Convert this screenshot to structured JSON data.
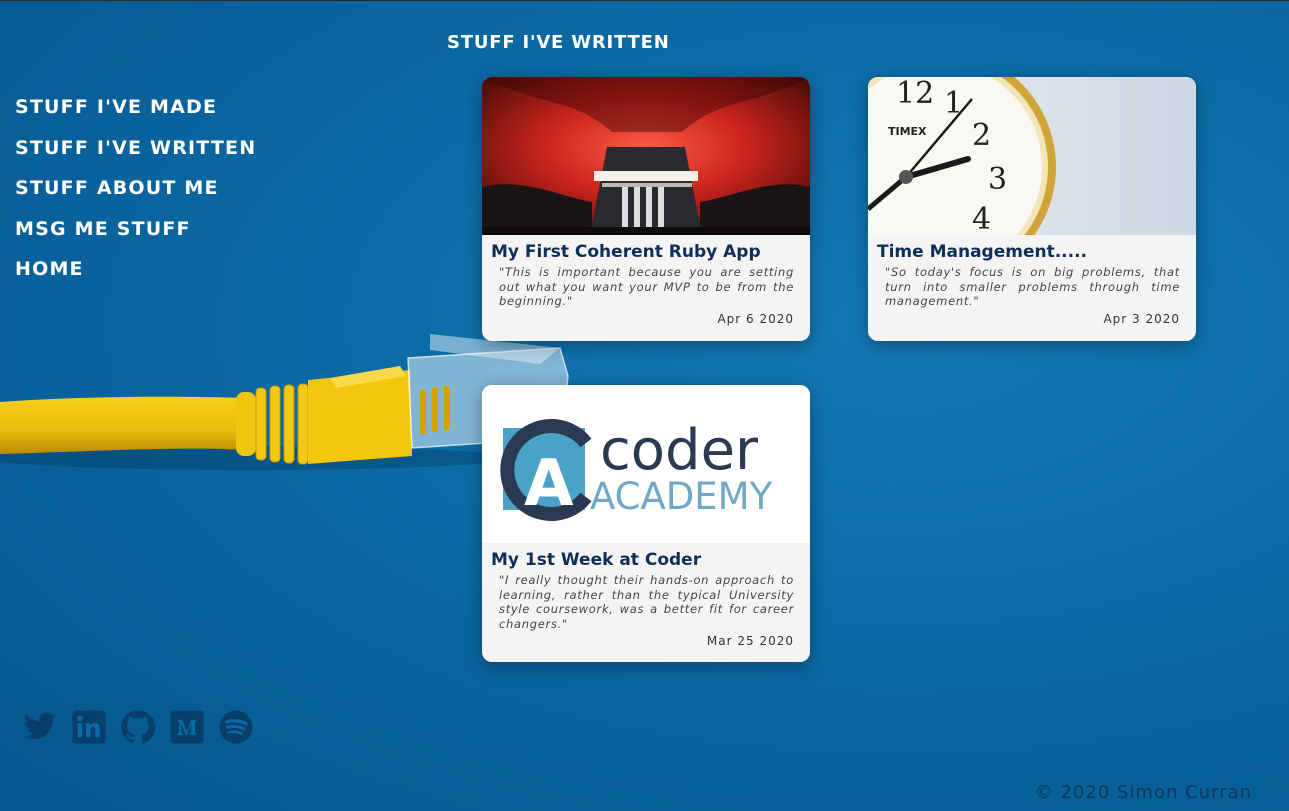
{
  "nav": {
    "items": [
      {
        "label": "STUFF I'VE MADE"
      },
      {
        "label": "STUFF I'VE WRITTEN"
      },
      {
        "label": "STUFF ABOUT ME"
      },
      {
        "label": "MSG ME STUFF"
      },
      {
        "label": "HOME"
      }
    ]
  },
  "page": {
    "section_title": "STUFF I'VE WRITTEN"
  },
  "posts": [
    {
      "title": "My First Coherent Ruby App",
      "excerpt": "\"This is important because you are setting out what you want your MVP to be from the beginning.\"",
      "date": "Apr 6 2020",
      "image": "red-cave-subway-station"
    },
    {
      "title": "Time Management.....",
      "excerpt": "\"So today's focus is on big problems, that turn into smaller problems through time management.\"",
      "date": "Apr 3 2020",
      "image": "timex-clock"
    },
    {
      "title": "My 1st Week at Coder",
      "excerpt": "\"I really thought their hands-on approach to learning, rather than the typical University style coursework, was a better fit for career changers.\"",
      "date": "Mar 25 2020",
      "image": "coder-academy-logo",
      "logo": {
        "line1": "coder",
        "line2": "ACADEMY",
        "letter": "A"
      }
    }
  ],
  "social": [
    {
      "icon": "twitter-icon"
    },
    {
      "icon": "linkedin-icon"
    },
    {
      "icon": "github-icon"
    },
    {
      "icon": "medium-icon"
    },
    {
      "icon": "spotify-icon"
    }
  ],
  "colors": {
    "accent": "#0f2f58",
    "icon": "#073f6a",
    "background": "#0b6aa6",
    "card": "#f4f4f4"
  },
  "footer": {
    "copyright": "© 2020 Simon Curran"
  }
}
